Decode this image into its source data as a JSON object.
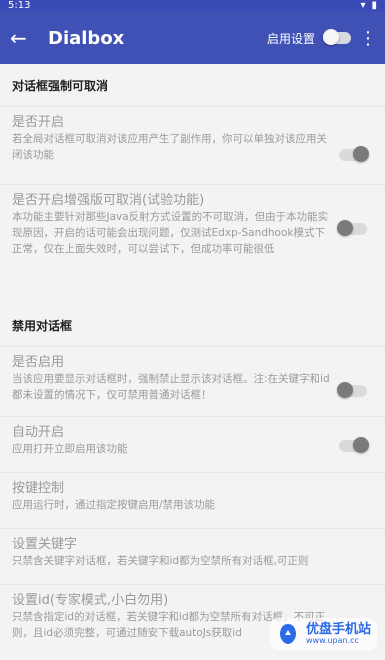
{
  "status_bar": {
    "time": "5:13",
    "icons": [
      "wifi-icon",
      "battery-icon"
    ]
  },
  "toolbar": {
    "title": "Dialbox",
    "enable_label": "启用设置",
    "back_icon": "arrow-left-icon",
    "menu_icon": "more-vert-icon"
  },
  "sections": [
    {
      "title": "对话框强制可取消",
      "items": [
        {
          "title": "是否开启",
          "desc": "若全局对话框可取消对该应用产生了副作用，你可以单独对该应用关闭该功能",
          "toggle": "on"
        },
        {
          "title": "是否开启增强版可取消(试验功能)",
          "desc": "本功能主要针对那些Java反射方式设置的不可取消，但由于本功能实现原因，开启的话可能会出现问题，仅测试Edxp-Sandhook模式下正常，仅在上面失效时，可以尝试下，但成功率可能很低",
          "toggle": "off"
        }
      ]
    },
    {
      "title": "禁用对话框",
      "items": [
        {
          "title": "是否启用",
          "desc": "当该应用要显示对话框时，强制禁止显示该对话框。注:在关键字和id都未设置的情况下，仅可禁用普通对话框！",
          "toggle": "off"
        },
        {
          "title": "自动开启",
          "desc": "应用打开立即启用该功能",
          "toggle": "on"
        },
        {
          "title": "按键控制",
          "desc": "应用运行时，通过指定按键启用/禁用该功能"
        },
        {
          "title": "设置关键字",
          "desc": "只禁含关键字对话框，若关键字和id都为空禁所有对话框,可正则"
        },
        {
          "title": "设置id(专家模式,小白勿用)",
          "desc": "只禁含指定id的对话框，若关键字和id都为空禁所有对话框，不可正则，且id必须完整，可通过随安下载autoJs获取id"
        }
      ]
    }
  ],
  "watermark": {
    "title": "优盘手机站",
    "subtitle": "www.upan.cc"
  }
}
